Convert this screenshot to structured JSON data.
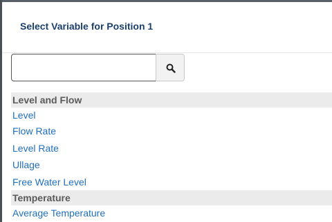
{
  "dialog": {
    "title": "Select Variable for Position 1"
  },
  "search": {
    "value": "",
    "placeholder": "",
    "button_icon": "search-icon"
  },
  "groups": [
    {
      "label": "Level and Flow",
      "items": [
        "Level",
        "Flow Rate",
        "Level Rate",
        "Ullage",
        "Free Water Level"
      ]
    },
    {
      "label": "Temperature",
      "items": [
        "Average Temperature"
      ]
    }
  ],
  "colors": {
    "title": "#1c3f6e",
    "link": "#1f6fbd",
    "group_bg": "#ebebeb",
    "group_text": "#5a5a5a"
  }
}
